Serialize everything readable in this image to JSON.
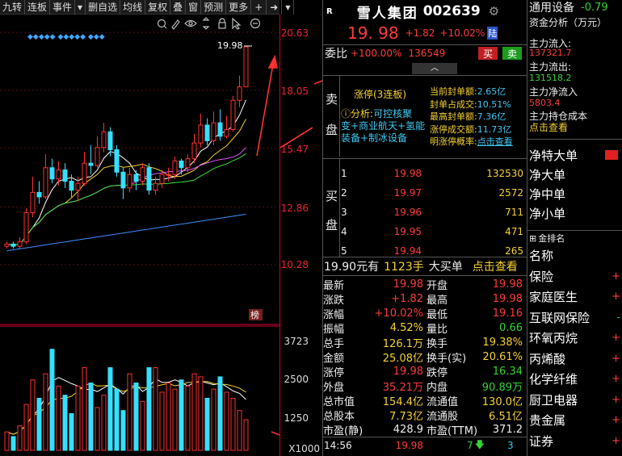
{
  "toolbar": {
    "items": [
      "九转",
      "连板",
      "事件",
      "删自选",
      "均线",
      "复权",
      "叠",
      "窗",
      "预测",
      "更多"
    ],
    "nav_add": "+",
    "nav_right": "➜"
  },
  "chart": {
    "price_labels": [
      "20.63",
      "18.05",
      "15.47",
      "12.86",
      "10.28"
    ],
    "current_price_tag": "19.98",
    "volume_labels": [
      "3723",
      "2500",
      "1250",
      "X1000"
    ],
    "badge_text": "榜",
    "markers": "◆◆◆◆◆   ◆◆◆◆◆         ◆◆◆"
  },
  "chart_data": {
    "type": "candlestick",
    "ylim": [
      10.28,
      20.63
    ],
    "candles": [
      {
        "o": 11.1,
        "c": 11.2,
        "h": 11.3,
        "l": 11.0
      },
      {
        "o": 11.2,
        "c": 11.1,
        "h": 11.3,
        "l": 11.0
      },
      {
        "o": 11.1,
        "c": 11.3,
        "h": 11.5,
        "l": 11.0
      },
      {
        "o": 11.3,
        "c": 12.6,
        "h": 12.8,
        "l": 11.2
      },
      {
        "o": 12.6,
        "c": 13.5,
        "h": 14.2,
        "l": 12.4
      },
      {
        "o": 13.5,
        "c": 13.3,
        "h": 14.0,
        "l": 13.0
      },
      {
        "o": 13.3,
        "c": 14.6,
        "h": 15.2,
        "l": 13.2
      },
      {
        "o": 14.6,
        "c": 14.1,
        "h": 15.0,
        "l": 13.9
      },
      {
        "o": 14.1,
        "c": 14.5,
        "h": 14.9,
        "l": 13.8
      },
      {
        "o": 14.5,
        "c": 14.0,
        "h": 14.8,
        "l": 13.7
      },
      {
        "o": 14.0,
        "c": 13.6,
        "h": 14.3,
        "l": 13.3
      },
      {
        "o": 13.6,
        "c": 13.9,
        "h": 14.2,
        "l": 13.1
      },
      {
        "o": 13.9,
        "c": 14.8,
        "h": 15.3,
        "l": 13.8
      },
      {
        "o": 14.8,
        "c": 14.7,
        "h": 15.6,
        "l": 14.3
      },
      {
        "o": 14.7,
        "c": 15.5,
        "h": 16.0,
        "l": 14.6
      },
      {
        "o": 15.5,
        "c": 16.2,
        "h": 16.6,
        "l": 15.3
      },
      {
        "o": 16.2,
        "c": 15.4,
        "h": 16.4,
        "l": 15.1
      },
      {
        "o": 15.4,
        "c": 14.4,
        "h": 15.6,
        "l": 14.2
      },
      {
        "o": 14.4,
        "c": 13.7,
        "h": 14.6,
        "l": 13.2
      },
      {
        "o": 13.7,
        "c": 14.3,
        "h": 14.6,
        "l": 13.5
      },
      {
        "o": 14.3,
        "c": 14.0,
        "h": 14.5,
        "l": 13.6
      },
      {
        "o": 14.0,
        "c": 14.6,
        "h": 14.8,
        "l": 13.8
      },
      {
        "o": 14.6,
        "c": 13.6,
        "h": 14.8,
        "l": 13.4
      },
      {
        "o": 13.6,
        "c": 13.9,
        "h": 14.2,
        "l": 13.4
      },
      {
        "o": 13.9,
        "c": 14.3,
        "h": 14.5,
        "l": 13.7
      },
      {
        "o": 14.3,
        "c": 14.3,
        "h": 14.6,
        "l": 14.0
      },
      {
        "o": 14.3,
        "c": 14.9,
        "h": 15.1,
        "l": 14.1
      },
      {
        "o": 14.9,
        "c": 14.6,
        "h": 15.0,
        "l": 14.3
      },
      {
        "o": 14.6,
        "c": 15.0,
        "h": 15.2,
        "l": 14.4
      },
      {
        "o": 15.0,
        "c": 15.7,
        "h": 16.1,
        "l": 14.8
      },
      {
        "o": 15.7,
        "c": 16.5,
        "h": 17.0,
        "l": 15.5
      },
      {
        "o": 16.5,
        "c": 15.8,
        "h": 16.8,
        "l": 15.6
      },
      {
        "o": 15.8,
        "c": 16.6,
        "h": 17.1,
        "l": 15.6
      },
      {
        "o": 16.6,
        "c": 16.0,
        "h": 17.2,
        "l": 15.8
      },
      {
        "o": 16.0,
        "c": 16.3,
        "h": 16.9,
        "l": 15.9
      },
      {
        "o": 16.3,
        "c": 17.6,
        "h": 17.8,
        "l": 16.2
      },
      {
        "o": 17.6,
        "c": 18.2,
        "h": 18.7,
        "l": 17.3
      },
      {
        "o": 18.2,
        "c": 19.98,
        "h": 19.98,
        "l": 18.2
      }
    ],
    "volumes": [
      600,
      450,
      800,
      1500,
      2300,
      1700,
      2500,
      3300,
      2100,
      1800,
      1200,
      2100,
      2700,
      2200,
      1400,
      1800,
      2700,
      2000,
      1300,
      2500,
      2200,
      1600,
      2700,
      2700,
      1900,
      2200,
      2000,
      2300,
      2100,
      2500,
      2400,
      1700,
      2000,
      2400,
      1900,
      1700,
      1300,
      1000
    ]
  },
  "header": {
    "badge": "R",
    "name": "雪人集团",
    "code": "002639",
    "price": "19. 98",
    "change": "+1.82",
    "change_pct": "+10.02%",
    "exchange": "陆"
  },
  "weibi": {
    "label": "委比",
    "pct": "+100.00%",
    "value": "136549",
    "sell_btn": "买",
    "buy_btn": "卖"
  },
  "limit_up": {
    "sell_side_label": "卖",
    "sell_side_label2": "盘",
    "status": "涨停(3连板)",
    "analysis_prefix": "分析:",
    "analysis_text1": "可控核聚",
    "analysis_text2": "变+商业航天+氢能",
    "analysis_text3": "装备+制冰设备",
    "stats": [
      {
        "k": "当前封单额:",
        "v": "2.65亿"
      },
      {
        "k": "封单占成交:",
        "v": "10.51%"
      },
      {
        "k": "最高封单额:",
        "v": "7.36亿"
      },
      {
        "k": "涨停成交额:",
        "v": "11.73亿"
      },
      {
        "k": "明涨停概率:",
        "v": "点击查看"
      }
    ]
  },
  "bid": {
    "label1": "买",
    "label2": "盘",
    "rows": [
      {
        "lvl": "1",
        "price": "19.98",
        "vol": "132530"
      },
      {
        "lvl": "2",
        "price": "19.97",
        "vol": "2572"
      },
      {
        "lvl": "3",
        "price": "19.96",
        "vol": "711"
      },
      {
        "lvl": "4",
        "price": "19.95",
        "vol": "471"
      },
      {
        "lvl": "5",
        "price": "19.94",
        "vol": "265"
      }
    ]
  },
  "big_order": {
    "price": "19.90元有",
    "amount": "1123手",
    "label": "大买单",
    "link": "点击查看"
  },
  "quote_left": [
    {
      "k": "最新",
      "v": "19.98",
      "c": "red"
    },
    {
      "k": "涨跌",
      "v": "+1.82",
      "c": "red"
    },
    {
      "k": "涨幅",
      "v": "+10.02%",
      "c": "red"
    },
    {
      "k": "振幅",
      "v": "4.52%",
      "c": "yellow"
    },
    {
      "k": "总手",
      "v": "126.1万",
      "c": "yellow"
    },
    {
      "k": "金额",
      "v": "25.08亿",
      "c": "yellow"
    },
    {
      "k": "涨停",
      "v": "19.98",
      "c": "red"
    },
    {
      "k": "外盘",
      "v": "35.21万",
      "c": "red"
    },
    {
      "k": "总市值",
      "v": "154.4亿",
      "c": "yellow"
    },
    {
      "k": "总股本",
      "v": "7.73亿",
      "c": "yellow"
    },
    {
      "k": "市盈(静)",
      "v": "428.9",
      "c": "white"
    }
  ],
  "quote_right": [
    {
      "k": "开盘",
      "v": "19.98",
      "c": "red"
    },
    {
      "k": "最高",
      "v": "19.98",
      "c": "red"
    },
    {
      "k": "最低",
      "v": "19.16",
      "c": "red"
    },
    {
      "k": "量比",
      "v": "0.66",
      "c": "green"
    },
    {
      "k": "换手",
      "v": "19.38%",
      "c": "yellow"
    },
    {
      "k": "换手(实)",
      "v": "20.61%",
      "c": "yellow"
    },
    {
      "k": "跌停",
      "v": "16.34",
      "c": "green"
    },
    {
      "k": "内盘",
      "v": "90.89万",
      "c": "green"
    },
    {
      "k": "流通值",
      "v": "130.0亿",
      "c": "yellow"
    },
    {
      "k": "流通股",
      "v": "6.51亿",
      "c": "yellow"
    },
    {
      "k": "市盈(TTM)",
      "v": "371.2",
      "c": "white"
    }
  ],
  "tick": {
    "time": "14:56",
    "price": "19.98",
    "vol": "7",
    "count": "3"
  },
  "side": {
    "title": "通用设备",
    "title_change": "-0.79",
    "flow_title": "资金分析（万元）",
    "inflow_label": "主力流入:",
    "inflow_value": "137321.7",
    "outflow_label": "主力流出:",
    "outflow_value": "131518.2",
    "net_label": "主力净流入",
    "net_value": "5803.4",
    "cost_label": "主力持仓成本",
    "cost_link": "点击查看",
    "items": [
      "净特大单",
      "净大单",
      "净中单",
      "净小单"
    ],
    "board_title": "金排名",
    "concepts": [
      "名称",
      "保险",
      "家庭医生",
      "互联网保险",
      "环氧丙烷",
      "丙烯酸",
      "化学纤维",
      "厨卫电器",
      "贵金属",
      "证券"
    ],
    "concept_marks": [
      "",
      "+",
      "+",
      "-",
      "+",
      "+",
      "+",
      "+",
      "+",
      "+"
    ]
  }
}
